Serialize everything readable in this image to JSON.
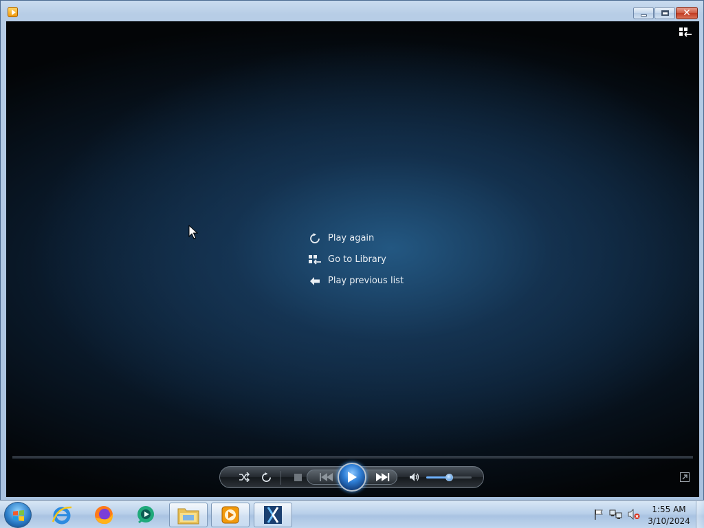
{
  "window": {
    "app_icon": "media-player-icon",
    "buttons": [
      "minimize",
      "maximize",
      "close"
    ],
    "close_glyph": "✕"
  },
  "player": {
    "menu": [
      {
        "icon": "replay-icon",
        "label": "Play again"
      },
      {
        "icon": "library-icon",
        "label": "Go to Library"
      },
      {
        "icon": "back-arrow-icon",
        "label": "Play previous list"
      }
    ],
    "volume_level": 0.5,
    "controls": [
      "shuffle",
      "repeat",
      "stop",
      "previous",
      "play",
      "next",
      "mute",
      "volume",
      "switch-to-now-playing"
    ]
  },
  "taskbar": {
    "pinned": [
      "internet-explorer",
      "firefox",
      "app-green",
      "explorer",
      "media-player",
      "snip-tool"
    ],
    "clock": {
      "time": "1:55 AM",
      "date": "3/10/2024"
    },
    "tray": [
      "action-center-flag-icon",
      "network-icon",
      "volume-muted-icon"
    ]
  },
  "colors": {
    "accent": "#2f7fd6",
    "stage_center": "#265f8c",
    "taskbar": "#b9d0ea"
  }
}
